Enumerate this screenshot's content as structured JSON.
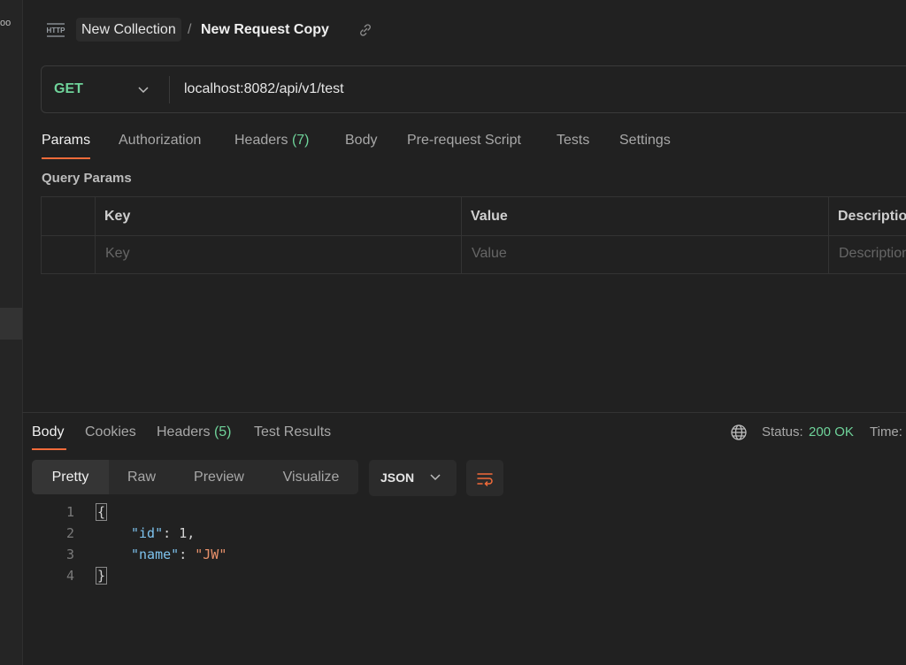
{
  "rail": {
    "glyph": "oo"
  },
  "header": {
    "icon_text": "HTTP",
    "collection": "New Collection",
    "separator": "/",
    "request": "New Request Copy"
  },
  "request": {
    "method": "GET",
    "url": "localhost:8082/api/v1/test",
    "tabs": [
      {
        "label": "Params",
        "count": ""
      },
      {
        "label": "Authorization",
        "count": ""
      },
      {
        "label": "Headers",
        "count": "(7)"
      },
      {
        "label": "Body",
        "count": ""
      },
      {
        "label": "Pre-request Script",
        "count": ""
      },
      {
        "label": "Tests",
        "count": ""
      },
      {
        "label": "Settings",
        "count": ""
      }
    ],
    "active_tab": "Params"
  },
  "query_params": {
    "title": "Query Params",
    "columns": [
      "Key",
      "Value",
      "Description"
    ],
    "placeholders": [
      "Key",
      "Value",
      "Description"
    ]
  },
  "response": {
    "tabs": [
      {
        "label": "Body",
        "count": ""
      },
      {
        "label": "Cookies",
        "count": ""
      },
      {
        "label": "Headers",
        "count": "(5)"
      },
      {
        "label": "Test Results",
        "count": ""
      }
    ],
    "active_tab": "Body",
    "status_label": "Status:",
    "status_value": "200 OK",
    "time_label": "Time:",
    "view_modes": [
      "Pretty",
      "Raw",
      "Preview",
      "Visualize"
    ],
    "active_view": "Pretty",
    "format": "JSON",
    "code": {
      "line_numbers": [
        "1",
        "2",
        "3",
        "4"
      ],
      "open_brace": "{",
      "close_brace": "}",
      "entries": [
        {
          "key": "\"id\"",
          "value": "1",
          "value_type": "number",
          "trailing": ","
        },
        {
          "key": "\"name\"",
          "value": "\"JW\"",
          "value_type": "string",
          "trailing": ""
        }
      ]
    }
  },
  "colors": {
    "background": "#212121",
    "accent_orange": "#f26b3a",
    "success_green": "#6fd39a",
    "json_key": "#7ec3ee",
    "json_string": "#e8916b"
  },
  "icons": {
    "http": "http-icon",
    "link": "link-icon",
    "chevron": "chevron-down-icon",
    "globe": "globe-icon",
    "wrap": "wrap-lines-icon"
  }
}
